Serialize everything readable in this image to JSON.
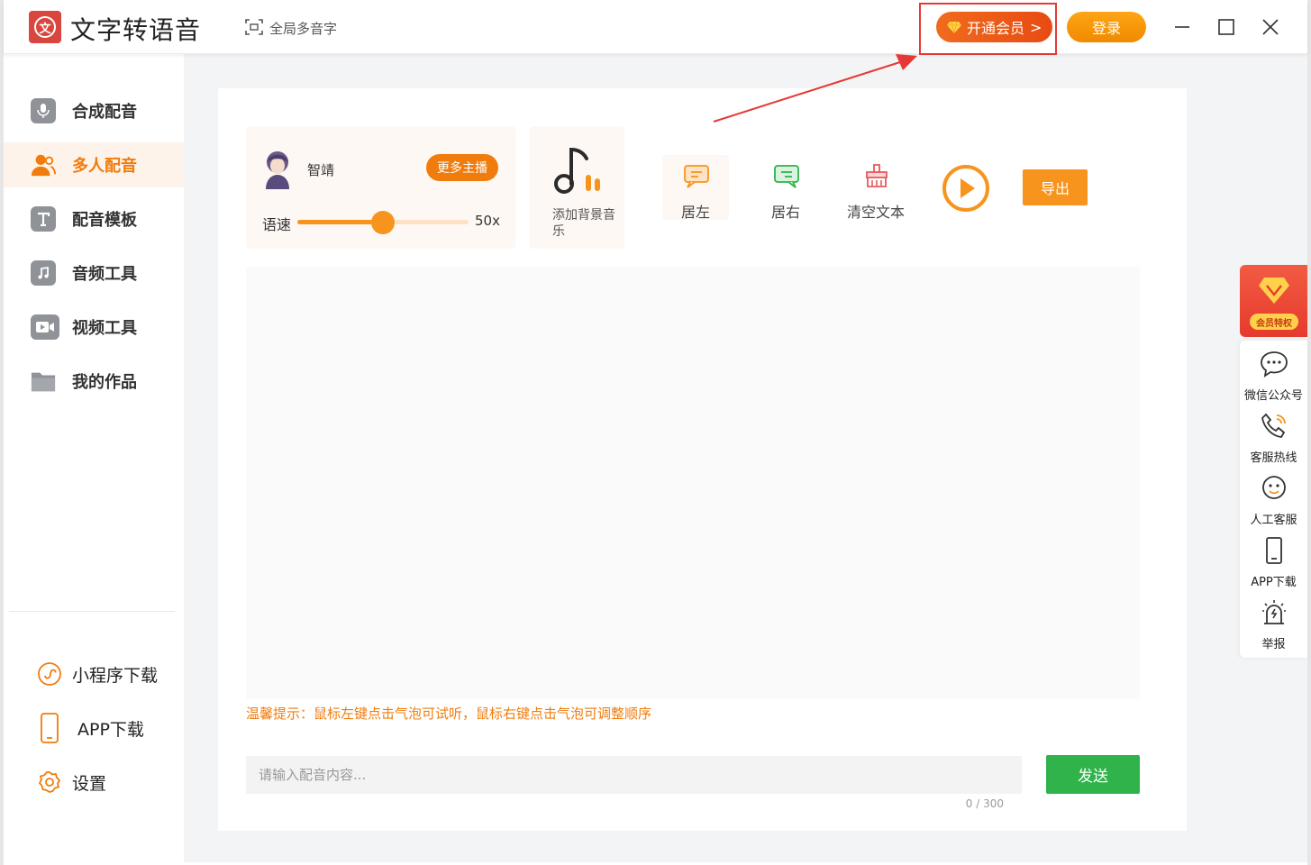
{
  "app": {
    "logo_char": "文",
    "title": "文字转语音",
    "poly_label": "全局多音字",
    "vip_label": "开通会员",
    "vip_chevron": ">",
    "login_label": "登录"
  },
  "sidebar": {
    "items": [
      {
        "label": "合成配音",
        "icon": "microphone-icon",
        "active": false
      },
      {
        "label": "多人配音",
        "icon": "users-icon",
        "active": true
      },
      {
        "label": "配音模板",
        "icon": "template-t-icon",
        "active": false
      },
      {
        "label": "音频工具",
        "icon": "music-note-icon",
        "active": false
      },
      {
        "label": "视频工具",
        "icon": "video-camera-icon",
        "active": false
      },
      {
        "label": "我的作品",
        "icon": "folder-icon",
        "active": false
      }
    ],
    "bottom": [
      {
        "label": "小程序下载",
        "icon": "miniprogram-icon"
      },
      {
        "label": "APP下载",
        "icon": "phone-icon"
      },
      {
        "label": "设置",
        "icon": "settings-icon"
      }
    ]
  },
  "voice": {
    "name": "智靖",
    "more_label": "更多主播",
    "speed_label": "语速",
    "speed_value": "50x",
    "speed_fraction": 0.5
  },
  "bgm": {
    "label": "添加背景音乐"
  },
  "tools": {
    "align_left": "居左",
    "align_right": "居右",
    "clear_text": "清空文本",
    "export_label": "导出"
  },
  "editor": {
    "hint": "温馨提示：鼠标左键点击气泡可试听，鼠标右键点击气泡可调整顺序",
    "input_placeholder": "请输入配音内容...",
    "counter": "0 / 300",
    "send_label": "发送"
  },
  "right_panel": {
    "vip_tag": "会员特权",
    "items": [
      {
        "label": "微信公众号",
        "icon": "chat-bubble-icon"
      },
      {
        "label": "客服热线",
        "icon": "phone-call-icon"
      },
      {
        "label": "人工客服",
        "icon": "agent-icon"
      },
      {
        "label": "APP下载",
        "icon": "mobile-icon"
      },
      {
        "label": "举报",
        "icon": "alarm-icon"
      }
    ]
  },
  "colors": {
    "accent": "#f07c0d",
    "send_green": "#2fb34a",
    "highlight_red": "#e53935"
  }
}
